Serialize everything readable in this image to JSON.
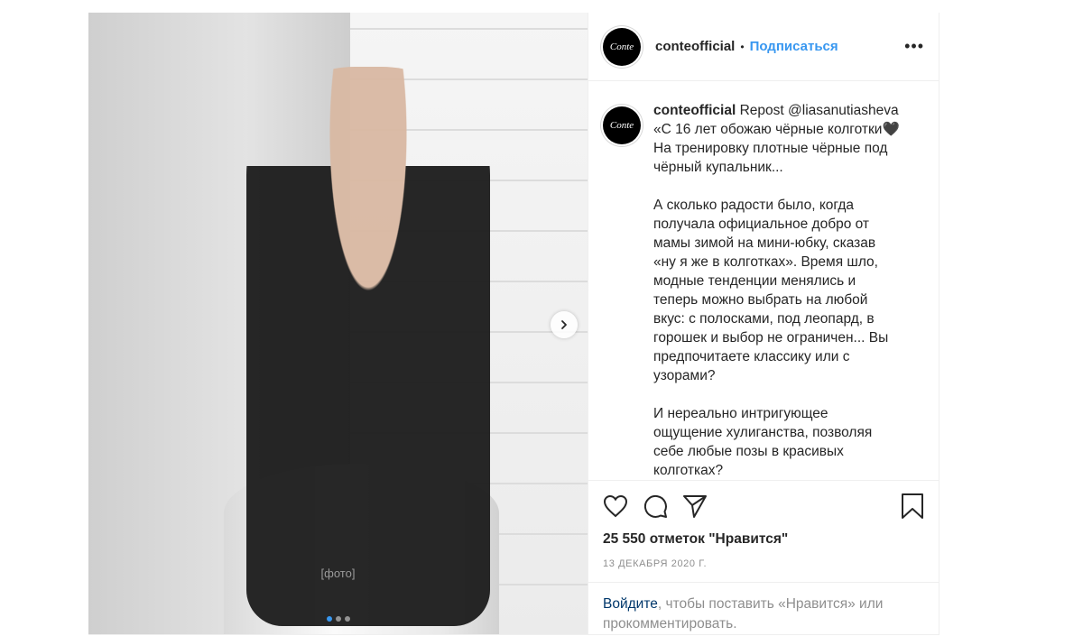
{
  "post": {
    "photo_alt": "[фото]",
    "carousel": {
      "dots": 3,
      "active": 1
    }
  },
  "header": {
    "avatar_text": "Conte",
    "username": "conteofficial",
    "separator": "•",
    "follow_label": "Подписаться",
    "more_label": "•••"
  },
  "caption": {
    "avatar_text": "Conte",
    "username": "conteofficial",
    "body": " Repost @liasanutiasheva\n«С 16 лет обожаю чёрные колготки🖤\nНа тренировку плотные чёрные под\nчёрный купальник...\n\nА сколько радости было, когда\nполучала официальное добро от\nмамы зимой на мини-юбку, сказав\n«ну я же в колготках». Время шло,\nмодные тенденции менялись и\nтеперь можно выбрать на любой\nвкус: с полосками, под леопард, в\nгорошек и выбор не ограничен... Вы\nпредпочитаете классику или с\nузорами?\n\nИ нереально интригующее\nощущение хулиганства, позволяя\nсебе любые позы в красивых\nколготках?"
  },
  "actions": {
    "like_icon": "heart-icon",
    "comment_icon": "comment-icon",
    "share_icon": "paper-plane-icon",
    "save_icon": "bookmark-icon"
  },
  "likes": "25 550 отметок \"Нравится\"",
  "date": "13 ДЕКАБРЯ 2020 Г.",
  "login": {
    "link": "Войдите",
    "rest": ", чтобы поставить «Нравится» или прокомментировать."
  },
  "colors": {
    "accent": "#3897f0",
    "text": "#262626",
    "muted": "#8e8e8e",
    "link": "#00376b"
  }
}
